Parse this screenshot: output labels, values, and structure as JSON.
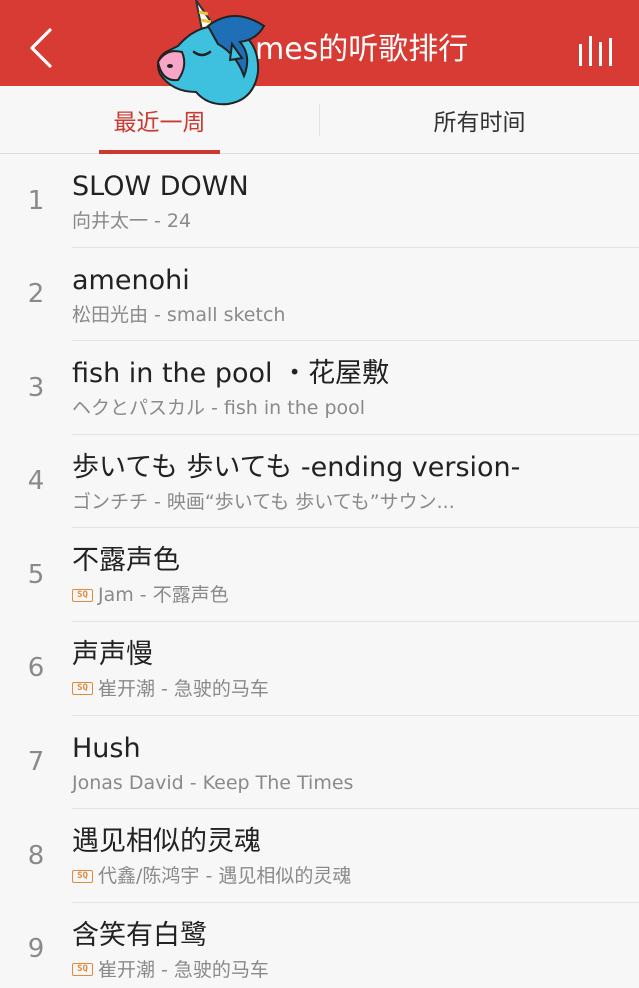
{
  "header": {
    "title": "mes的听歌排行",
    "colors": {
      "bar": "#d83b33",
      "accent": "#c93a31"
    },
    "back_icon": "chevron-left-icon",
    "playing_icon": "now-playing-bars-icon"
  },
  "tabs": [
    {
      "label": "最近一周",
      "active": true
    },
    {
      "label": "所有时间",
      "active": false
    }
  ],
  "songs": [
    {
      "rank": "1",
      "title": "SLOW DOWN",
      "sub": "向井太一 - 24",
      "sq": false
    },
    {
      "rank": "2",
      "title": "amenohi",
      "sub": "松田光由 - small sketch",
      "sq": false
    },
    {
      "rank": "3",
      "title": "fish in the pool ・花屋敷",
      "sub": "ヘクとパスカル - fish in the pool",
      "sq": false
    },
    {
      "rank": "4",
      "title": "歩いても 歩いても -ending version-",
      "sub": "ゴンチチ - 映画“歩いても 歩いても”サウン...",
      "sq": false
    },
    {
      "rank": "5",
      "title": "不露声色",
      "sub": "Jam - 不露声色",
      "sq": true
    },
    {
      "rank": "6",
      "title": "声声慢",
      "sub": "崔开潮 - 急驶的马车",
      "sq": true
    },
    {
      "rank": "7",
      "title": "Hush",
      "sub": "Jonas David - Keep The Times",
      "sq": false
    },
    {
      "rank": "8",
      "title": "遇见相似的灵魂",
      "sub": "代鑫/陈鸿宇 - 遇见相似的灵魂",
      "sq": true
    },
    {
      "rank": "9",
      "title": "含笑有白鹭",
      "sub": "崔开潮 - 急驶的马车",
      "sq": true
    }
  ],
  "sq_badge": "SQ"
}
